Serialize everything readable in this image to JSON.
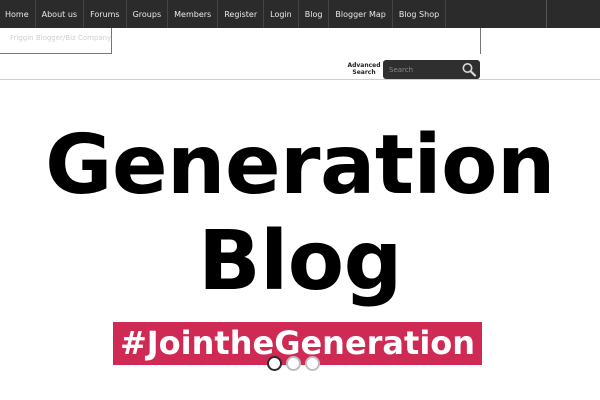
{
  "nav": {
    "items": [
      "Home",
      "About us",
      "Forums",
      "Groups",
      "Members",
      "Register",
      "Login",
      "Blog",
      "Blogger Map",
      "Blog Shop"
    ]
  },
  "subnav": {
    "faded_text": "Friggin Blogger/Biz Company"
  },
  "search": {
    "advanced_label": "Advanced Search",
    "placeholder": "Search",
    "icon": "search-icon"
  },
  "hero": {
    "title_line1": "Generation",
    "title_line2": "Blog",
    "hashtag": "#JointheGeneration"
  },
  "slider": {
    "dots": 3,
    "active_index": 0
  },
  "colors": {
    "nav_bg": "#2b2b2b",
    "hashtag_bg": "#cf2a53"
  }
}
